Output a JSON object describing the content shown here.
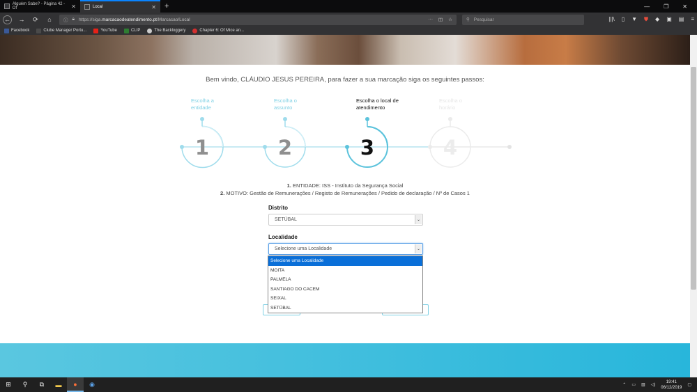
{
  "browser": {
    "tabs": [
      {
        "title": "Alguém Sabe? - Página 42 - Of",
        "active": false
      },
      {
        "title": "Local",
        "active": true
      }
    ],
    "url_prefix": "https://siga.",
    "url_domain": "marcacaodeatendimento.pt",
    "url_path": "/Marcacao/Local",
    "search_placeholder": "Pesquisar",
    "bookmarks": [
      {
        "label": "Facebook",
        "color": "#3b5998"
      },
      {
        "label": "Clube Manager Portu...",
        "color": "#4a4a4a"
      },
      {
        "label": "YouTube",
        "color": "#e62117"
      },
      {
        "label": "CLIP",
        "color": "#2e7d32"
      },
      {
        "label": "The Backloggery",
        "color": "#cccccc"
      },
      {
        "label": "Chapter 6: Of Mice an...",
        "color": "#d32f2f"
      }
    ]
  },
  "page": {
    "welcome": "Bem vindo, CLÁUDIO JESUS PEREIRA, para fazer a sua marcação siga os seguintes passos:",
    "steps": [
      {
        "number": "1",
        "label": "Escolha a entidade",
        "state": "done"
      },
      {
        "number": "2",
        "label": "Escolha o assunto",
        "state": "done"
      },
      {
        "number": "3",
        "label": "Escolha o local de atendimento",
        "state": "current"
      },
      {
        "number": "4",
        "label": "Escolha o horário",
        "state": "future"
      }
    ],
    "summary": {
      "line1_num": "1.",
      "line1_text": " ENTIDADE: ISS - Instituto da Segurança Social",
      "line2_num": "2.",
      "line2_text": " MOTIVO: Gestão de Remunerações / Registo de Remunerações / Pedido de declaração / Nº de Casos 1"
    },
    "distrito": {
      "label": "Distrito",
      "value": "SETÚBAL"
    },
    "localidade": {
      "label": "Localidade",
      "value": "Selecione uma Localidade",
      "options": [
        "Selecione uma Localidade",
        "MOITA",
        "PALMELA",
        "SANTIAGO DO CACEM",
        "SEIXAL",
        "SETÚBAL"
      ],
      "selected_index": 0
    },
    "colors": {
      "accent": "#7fd0e4",
      "footer": "#28b6db",
      "dropdown_highlight": "#0a6fd8"
    }
  },
  "taskbar": {
    "time": "19:41",
    "date": "06/12/2019"
  }
}
